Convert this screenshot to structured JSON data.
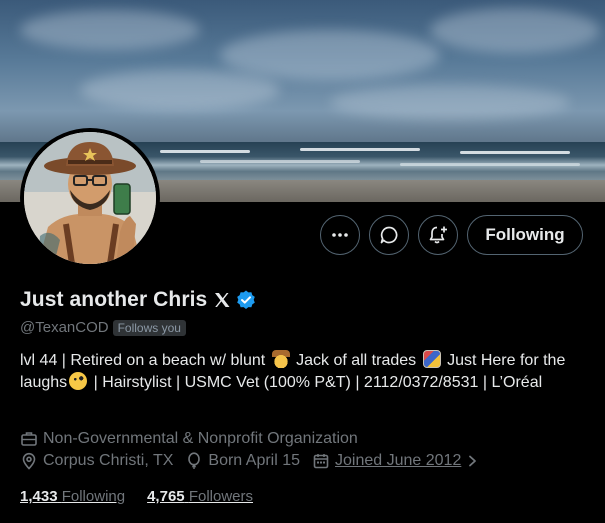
{
  "colors": {
    "background": "#000000",
    "text": "#e7e9ea",
    "muted": "#71767b",
    "verified": "#1d9bf0",
    "border": "#536471"
  },
  "profile": {
    "display_name": "Just another Chris",
    "handle": "@TexanCOD",
    "follows_you": "Follows you",
    "bio": {
      "part1": "lvl 44 | Retired on a beach w/ blunt",
      "emoji1": "cowboy-emoji",
      "part2": "Jack of all trades",
      "emoji2": "joker-card-emoji",
      "part3": "Just Here for the laughs",
      "emoji3": "zany-face-emoji",
      "part4": "| Hairstylist | USMC Vet (100% P&T) | 2112/0372/8531 | L’Oréal"
    },
    "category": "Non-Governmental & Nonprofit Organization",
    "location": "Corpus Christi, TX",
    "birthday": "Born April 15",
    "joined": "Joined June 2012"
  },
  "actions": {
    "following_label": "Following"
  },
  "stats": {
    "following_count": "1,433",
    "following_label": "Following",
    "followers_count": "4,765",
    "followers_label": "Followers"
  }
}
